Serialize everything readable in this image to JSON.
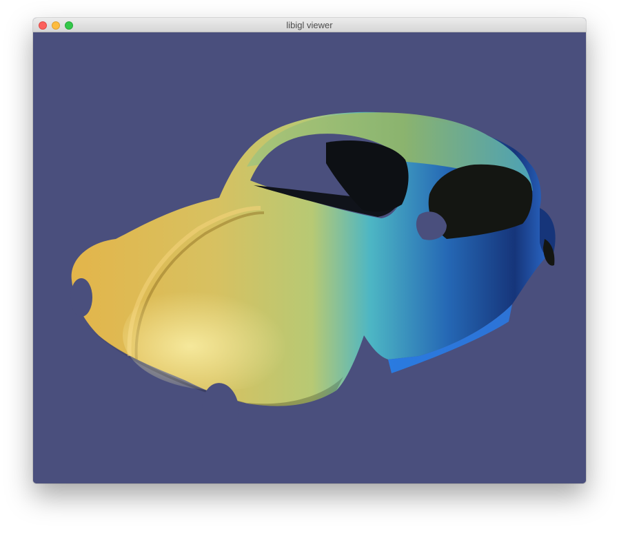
{
  "window": {
    "title": "libigl viewer",
    "background_color": "#4a4f7d"
  },
  "controls": {
    "close": "close-button",
    "minimize": "minimize-button",
    "zoom": "zoom-button"
  },
  "scene": {
    "model": "car-body-mesh",
    "colormap": [
      "#e8b94a",
      "#c8cf74",
      "#44b6c7",
      "#2b5eb8",
      "#102a66"
    ]
  }
}
